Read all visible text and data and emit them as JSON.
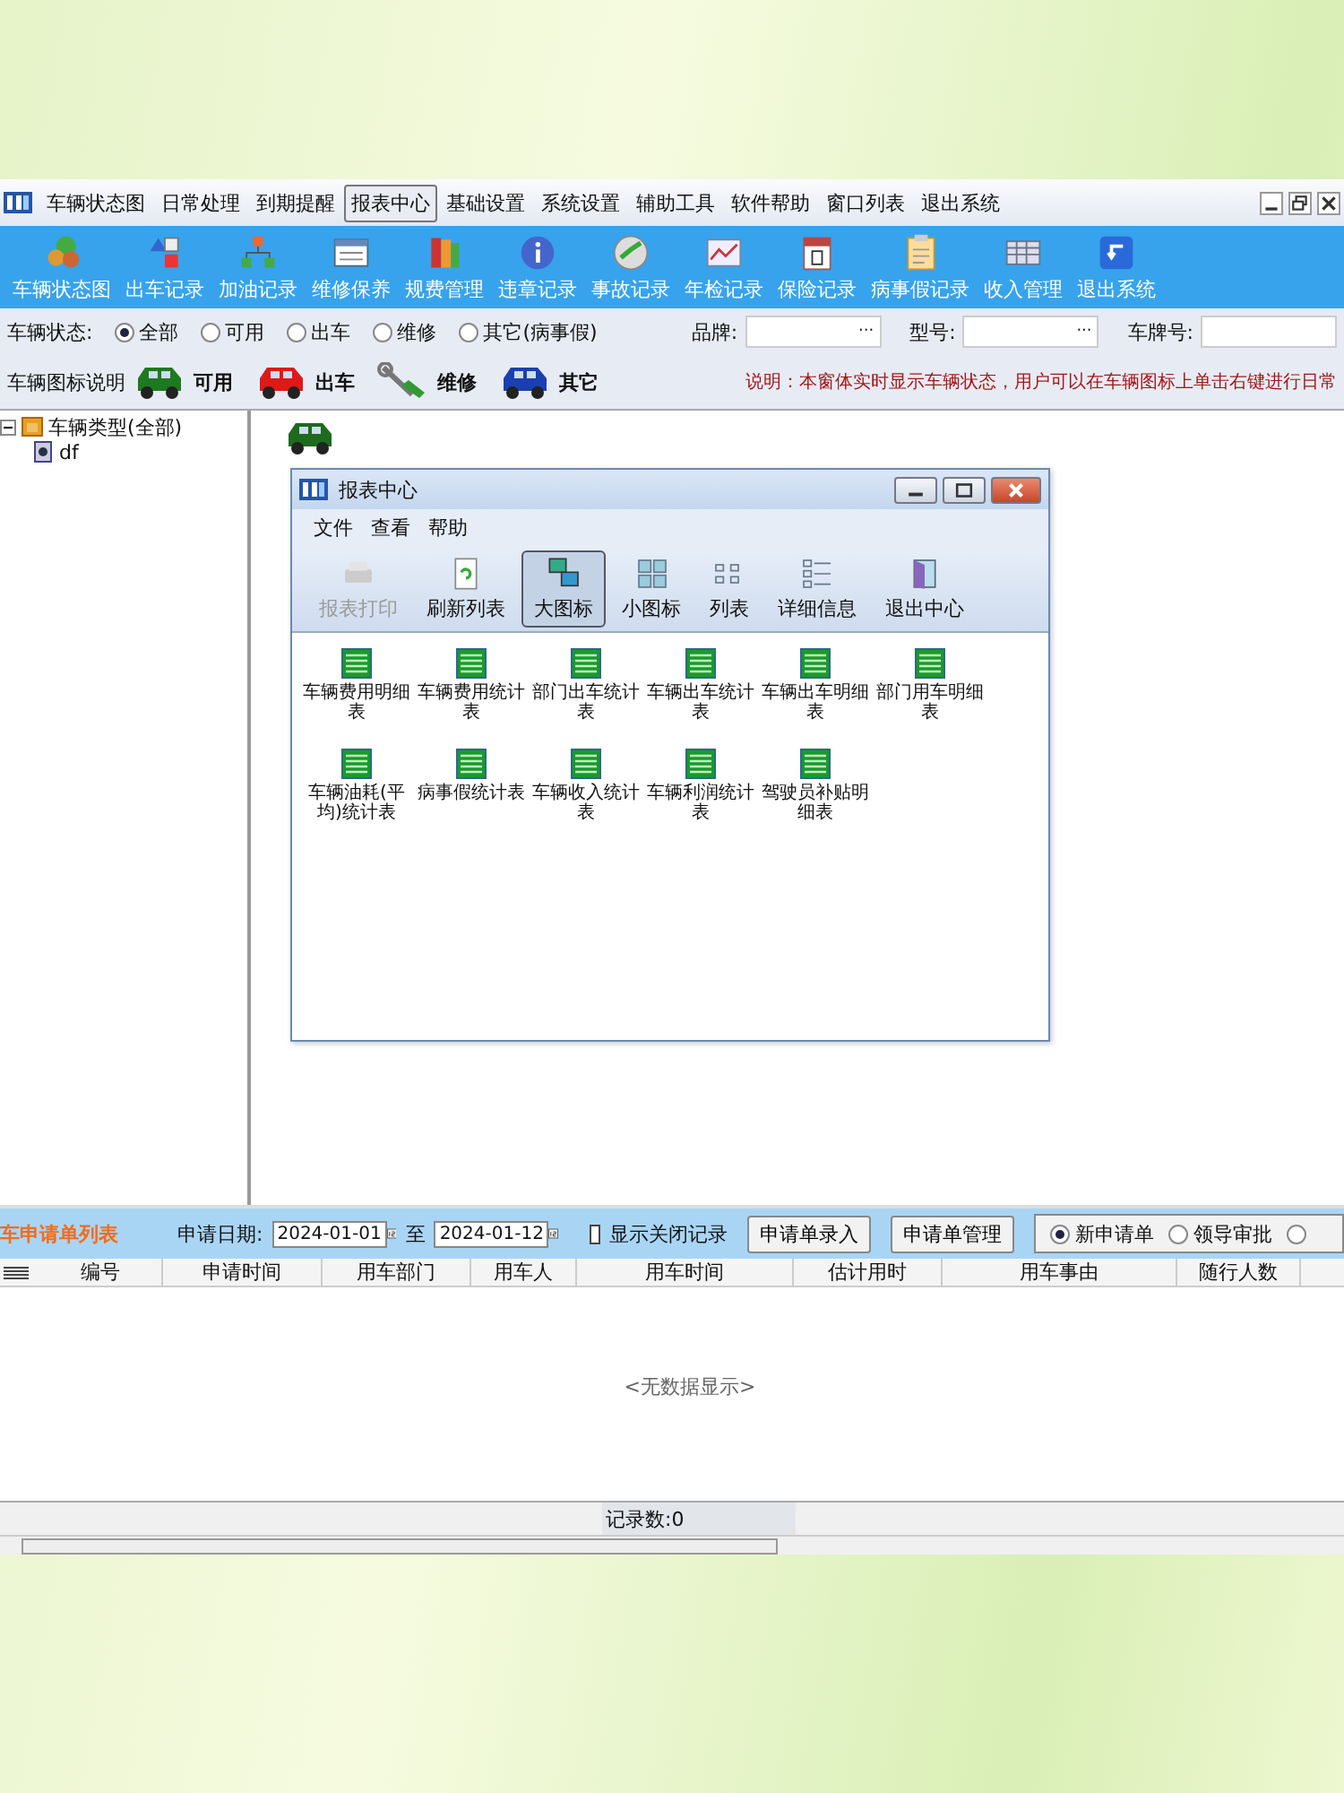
{
  "menu": [
    {
      "label": "车辆状态图",
      "selected": false
    },
    {
      "label": "日常处理",
      "selected": false
    },
    {
      "label": "到期提醒",
      "selected": false
    },
    {
      "label": "报表中心",
      "selected": true
    },
    {
      "label": "基础设置",
      "selected": false
    },
    {
      "label": "系统设置",
      "selected": false
    },
    {
      "label": "辅助工具",
      "selected": false
    },
    {
      "label": "软件帮助",
      "selected": false
    },
    {
      "label": "窗口列表",
      "selected": false
    },
    {
      "label": "退出系统",
      "selected": false
    }
  ],
  "toolbar": [
    {
      "label": "车辆状态图"
    },
    {
      "label": "出车记录"
    },
    {
      "label": "加油记录"
    },
    {
      "label": "维修保养"
    },
    {
      "label": "规费管理"
    },
    {
      "label": "违章记录"
    },
    {
      "label": "事故记录"
    },
    {
      "label": "年检记录"
    },
    {
      "label": "保险记录"
    },
    {
      "label": "病事假记录"
    },
    {
      "label": "收入管理"
    },
    {
      "label": "退出系统"
    }
  ],
  "filter": {
    "label": "车辆状态:",
    "options": [
      {
        "label": "全部",
        "selected": true
      },
      {
        "label": "可用",
        "selected": false
      },
      {
        "label": "出车",
        "selected": false
      },
      {
        "label": "维修",
        "selected": false
      },
      {
        "label": "其它(病事假)",
        "selected": false
      }
    ],
    "fields": [
      {
        "label": "品牌:",
        "button": "···"
      },
      {
        "label": "型号:",
        "button": "···"
      },
      {
        "label": "车牌号:"
      }
    ]
  },
  "legend": {
    "label": "车辆图标说明",
    "items": [
      {
        "kind": "car",
        "label": "可用",
        "color": "#1e7a1e"
      },
      {
        "kind": "car",
        "label": "出车",
        "color": "#e01818"
      },
      {
        "kind": "tool",
        "label": "维修"
      },
      {
        "kind": "car",
        "label": "其它",
        "color": "#1a3fb0"
      }
    ],
    "note": "说明：本窗体实时显示车辆状态，用户可以在车辆图标上单击右键进行日常"
  },
  "tree": [
    {
      "label": "车辆类型(全部)",
      "expanded": true,
      "children": [
        {
          "label": "df"
        }
      ]
    }
  ],
  "report_window": {
    "title": "报表中心",
    "menu": [
      "文件",
      "查看",
      "帮助"
    ],
    "tools": [
      {
        "label": "报表打印",
        "disabled": true,
        "selected": false
      },
      {
        "label": "刷新列表",
        "disabled": false,
        "selected": false
      },
      {
        "label": "大图标",
        "disabled": false,
        "selected": true
      },
      {
        "label": "小图标",
        "disabled": false,
        "selected": false
      },
      {
        "label": "列表",
        "disabled": false,
        "selected": false
      },
      {
        "label": "详细信息",
        "disabled": false,
        "selected": false
      },
      {
        "label": "退出中心",
        "disabled": false,
        "selected": false
      }
    ],
    "reports": [
      "车辆费用明细表",
      "车辆费用统计表",
      "部门出车统计表",
      "车辆出车统计表",
      "车辆出车明细表",
      "部门用车明细表",
      "车辆油耗(平均)统计表",
      "病事假统计表",
      "车辆收入统计表",
      "车辆利润统计表",
      "驾驶员补贴明细表"
    ]
  },
  "requests": {
    "title": "车申请单列表",
    "date_label": "申请日期:",
    "date_from": "2024-01-01",
    "to_label": "至",
    "date_to": "2024-01-12",
    "show_closed": {
      "label": "显示关闭记录",
      "checked": false
    },
    "buttons": [
      "申请单录入",
      "申请单管理"
    ],
    "modes": [
      {
        "label": "新申请单",
        "selected": true
      },
      {
        "label": "领导审批",
        "selected": false
      },
      {
        "selected": false
      }
    ],
    "columns": [
      "编号",
      "申请时间",
      "用车部门",
      "用车人",
      "用车时间",
      "估计用时",
      "用车事由",
      "随行人数"
    ],
    "empty_text": "<无数据显示>",
    "status": "记录数:0"
  }
}
